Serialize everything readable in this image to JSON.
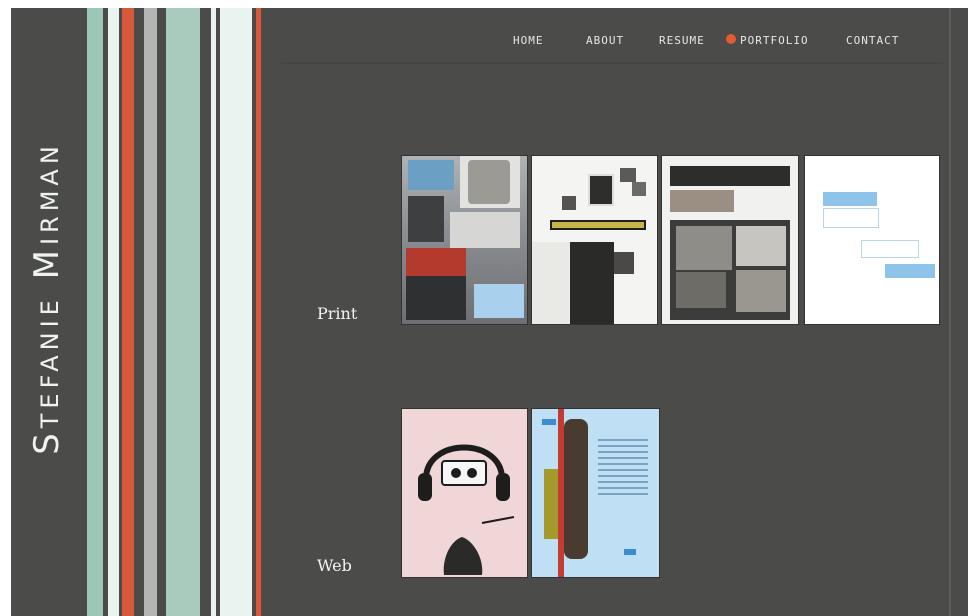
{
  "brand": {
    "name": "Stefanie Mirman"
  },
  "nav": {
    "items": [
      "HOME",
      "ABOUT",
      "RESUME",
      "PORTFOLIO",
      "CONTACT"
    ],
    "active": "PORTFOLIO"
  },
  "sections": {
    "print_label": "Print",
    "web_label": "Web"
  },
  "colors": {
    "background": "#4b4c4a",
    "accent": "#d9573a",
    "mint": "#9cc6b6"
  }
}
